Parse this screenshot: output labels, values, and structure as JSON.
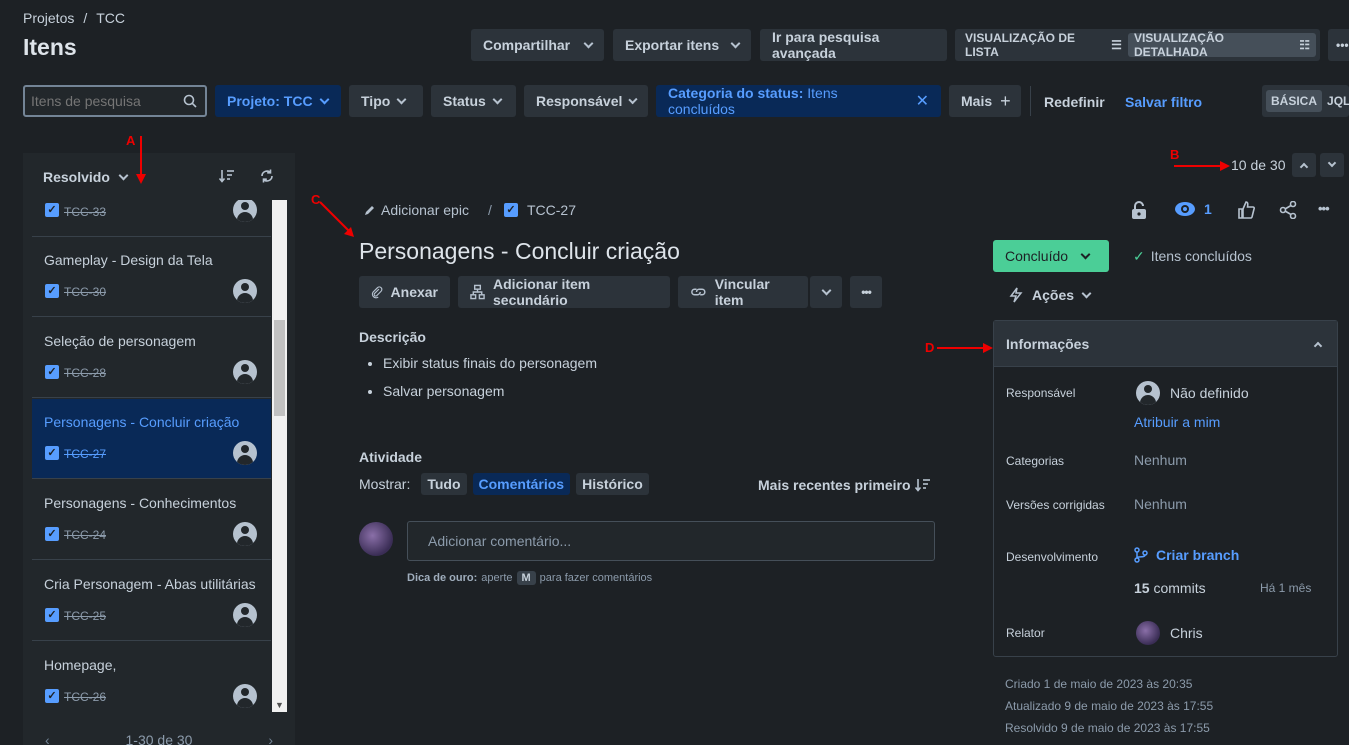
{
  "breadcrumb": {
    "root": "Projetos",
    "sep": "/",
    "project": "TCC"
  },
  "page_title": "Itens",
  "header": {
    "share": "Compartilhar",
    "export": "Exportar itens",
    "advanced": "Ir para pesquisa avançada",
    "list_view": "VISUALIZAÇÃO DE LISTA",
    "detail_view": "VISUALIZAÇÃO DETALHADA",
    "more": "•••"
  },
  "filters": {
    "search_placeholder": "Itens de pesquisa",
    "project_key": "Projeto:",
    "project_val": "TCC",
    "type": "Tipo",
    "status": "Status",
    "assignee": "Responsável",
    "category_key": "Categoria do status:",
    "category_val": "Itens concluídos",
    "more": "Mais",
    "reset": "Redefinir",
    "save": "Salvar filtro",
    "basic": "BÁSICA",
    "jql": "JQL"
  },
  "list": {
    "sort_label": "Resolvido",
    "items": [
      {
        "title": "",
        "key": "TCC-33"
      },
      {
        "title": "Gameplay - Design da Tela",
        "key": "TCC-30"
      },
      {
        "title": "Seleção de personagem",
        "key": "TCC-28"
      },
      {
        "title": "Personagens - Concluir criação",
        "key": "TCC-27"
      },
      {
        "title": "Personagens - Conhecimentos",
        "key": "TCC-24"
      },
      {
        "title": "Cria Personagem - Abas utilitárias",
        "key": "TCC-25"
      },
      {
        "title": "Homepage,",
        "key": "TCC-26"
      }
    ],
    "pagination": "1-30 de 30"
  },
  "pager": {
    "text": "10 de 30"
  },
  "annotations": {
    "a": "A",
    "b": "B",
    "c": "C",
    "d": "D"
  },
  "issue": {
    "epic": "Adicionar epic",
    "sep": "/",
    "key": "TCC-27",
    "title": "Personagens - Concluir criação",
    "watchers": "1",
    "actions": {
      "attach": "Anexar",
      "child": "Adicionar item secundário",
      "link": "Vincular item",
      "more": "•••"
    },
    "description_label": "Descrição",
    "description": [
      "Exibir status finais do personagem",
      "Salvar personagem"
    ],
    "activity": {
      "label": "Atividade",
      "show": "Mostrar:",
      "all": "Tudo",
      "comments": "Comentários",
      "history": "Histórico",
      "sort": "Mais recentes primeiro",
      "comment_placeholder": "Adicionar comentário...",
      "tip_bold": "Dica de ouro:",
      "tip_a": "aperte",
      "tip_key": "M",
      "tip_b": "para fazer comentários"
    }
  },
  "status": {
    "button": "Concluído",
    "category": "Itens concluídos",
    "actions": "Ações"
  },
  "details": {
    "header": "Informações",
    "assignee_label": "Responsável",
    "assignee_value": "Não definido",
    "assign_me": "Atribuir a mim",
    "categories_label": "Categorias",
    "categories_value": "Nenhum",
    "fix_label": "Versões corrigidas",
    "fix_value": "Nenhum",
    "dev_label": "Desenvolvimento",
    "create_branch": "Criar branch",
    "commits_count": "15",
    "commits_word": "commits",
    "commits_age": "Há 1 mês",
    "reporter_label": "Relator",
    "reporter_value": "Chris"
  },
  "dates": {
    "created": "Criado 1 de maio de 2023 às 20:35",
    "updated": "Atualizado 9 de maio de 2023 às 17:55",
    "resolved": "Resolvido 9 de maio de 2023 às 17:55"
  },
  "colors": {
    "accent": "#579dff",
    "success": "#4bce97",
    "annotation": "#ee0000"
  }
}
